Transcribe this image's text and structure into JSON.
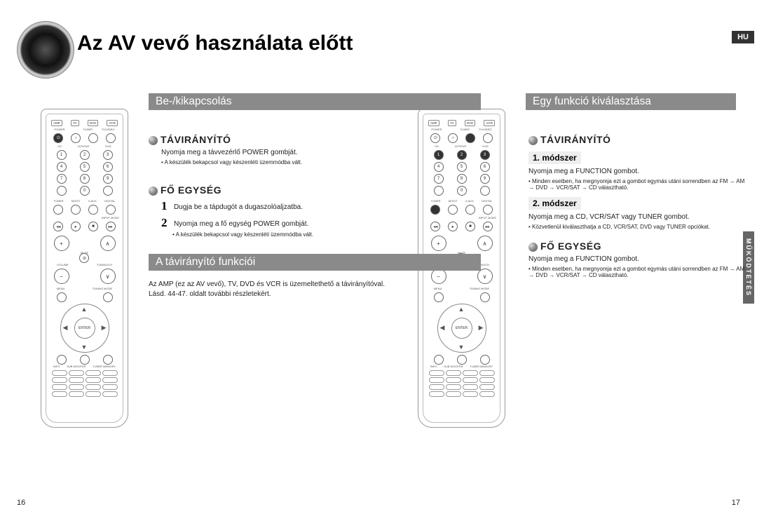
{
  "lang_badge": "HU",
  "side_label": "MŰKÖDTETÉS",
  "page_title": "Az AV vevő használata előtt",
  "left": {
    "bar1": "Be-/kikapcsolás",
    "sub1": "TÁVIRÁNYÍTÓ",
    "line1": "Nyomja meg a távvezérlő POWER gombját.",
    "note1": "• A készülék bekapcsol vagy készenléti üzemmódba vált.",
    "sub2": "FŐ EGYSÉG",
    "step1_num": "1",
    "step1": "Dugja be a tápdugót a dugaszolóaljzatba.",
    "step2_num": "2",
    "step2": "Nyomja meg a fő egység POWER gombját.",
    "step2_note": "• A készülék bekapcsol vagy készenléti üzemmódba vált.",
    "bar2": "A távirányító funkciói",
    "body2a": "Az AMP (ez az AV vevő), TV, DVD és VCR is üzemeltethető a távirányítóval.",
    "body2b": "Lásd. 44-47. oldalt további részletekért."
  },
  "right": {
    "bar1": "Egy funkció kiválasztása",
    "sub1": "TÁVIRÁNYÍTÓ",
    "m1": "1. módszer",
    "m1_line": "Nyomja meg a FUNCTION gombot.",
    "m1_note": "• Minden esetben, ha megnyomja ezt a gombot egymás utáni sorrendben az FM → AM → DVD → VCR/SAT → CD választható.",
    "m2": "2. módszer",
    "m2_line": "Nyomja meg a CD, VCR/SAT vagy TUNER gombot.",
    "m2_note": "• Közvetlenül kiválaszthatja a CD, VCR/SAT, DVD vagy TUNER opciókat.",
    "sub2": "FŐ EGYSÉG",
    "fe_line": "Nyomja meg a FUNCTION gombot.",
    "fe_note": "• Minden esetben, ha megnyomja ezt a gombot egymás utáni sorrendben az FM → AM → DVD → VCR/SAT → CD választható."
  },
  "remote_labels": {
    "sel": [
      "AMP",
      "TV",
      "DVD",
      "VCR"
    ],
    "row2": [
      "POWER",
      "",
      "TUNER",
      "TV/VIDEO"
    ],
    "row3": [
      "CD",
      "VCR/SAT",
      "DVD"
    ],
    "nums": [
      "1",
      "2",
      "3",
      "4",
      "5",
      "6",
      "7",
      "8",
      "9",
      "0"
    ],
    "vol": "VOLUME",
    "tune": "TUNING/CH",
    "mute": "MUTE",
    "menu": "MENU",
    "tmode": "TUNING MODE",
    "enter": "ENTER",
    "info": "INFO",
    "sub": "SUB WOOFER",
    "tmem": "TUNER MEMORY"
  },
  "page_left": "16",
  "page_right": "17"
}
